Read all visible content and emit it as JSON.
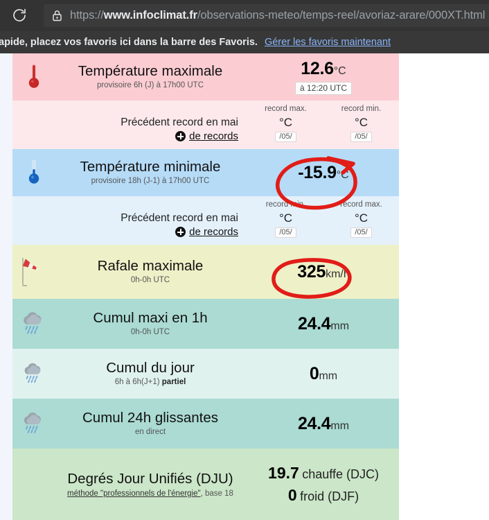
{
  "browser": {
    "reload_icon": "reload-icon",
    "lock_icon": "lock-icon",
    "url_scheme": "https://",
    "url_host": "www.infoclimat.fr",
    "url_path": "/observations-meteo/temps-reel/avoriaz-arare/000XT.html",
    "url_full": "https://www.infoclimat.fr/observations-meteo/temps-reel/avoriaz-arare/000XT.html"
  },
  "bookmarks_bar": {
    "message": "apide, placez vos favoris ici dans la barre des Favoris.",
    "link_label": "Gérer les favoris maintenant"
  },
  "rows": {
    "tmax": {
      "icon": "thermometer-red-icon",
      "title": "Température maximale",
      "subtitle": "provisoire 6h (J) à 17h00 UTC",
      "value": "12.6",
      "unit": "°C",
      "time_badge": "à 12:20 UTC"
    },
    "record_max": {
      "label": "Précédent record en mai",
      "more_label": "de records",
      "more_icon": "plus-circle-icon",
      "col1_header": "record max.",
      "col1_value": "°C",
      "col1_date": "/05/",
      "col2_header": "record min.",
      "col2_value": "°C",
      "col2_date": "/05/"
    },
    "tmin": {
      "icon": "thermometer-blue-icon",
      "title": "Température minimale",
      "subtitle": "provisoire 18h (J-1) à 17h00 UTC",
      "value": "-15.9",
      "unit": "°C"
    },
    "record_min": {
      "label": "Précédent record en mai",
      "more_label": "de records",
      "more_icon": "plus-circle-icon",
      "col1_header": "record min.",
      "col1_value": "°C",
      "col1_date": "/05/",
      "col2_header": "record max.",
      "col2_value": "°C",
      "col2_date": "/05/"
    },
    "gust": {
      "icon": "windsock-icon",
      "title": "Rafale maximale",
      "subtitle": "0h-0h UTC",
      "value": "325",
      "unit": "km/h"
    },
    "rain_1h": {
      "icon": "rain-cloud-icon",
      "title": "Cumul maxi en 1h",
      "subtitle": "0h-0h UTC",
      "value": "24.4",
      "unit": "mm"
    },
    "rain_day": {
      "icon": "rain-cloud-icon",
      "title": "Cumul du jour",
      "subtitle_plain": "6h à 6h(J+1) ",
      "subtitle_bold": "partiel",
      "value": "0",
      "unit": "mm"
    },
    "rain_24h": {
      "icon": "rain-cloud-icon",
      "title": "Cumul 24h glissantes",
      "subtitle": "en direct",
      "value": "24.4",
      "unit": "mm"
    },
    "dju": {
      "title": "Degrés Jour Unifiés (DJU)",
      "subtitle_link": "méthode \"professionnels de l'énergie\"",
      "subtitle_rest": ", base 18",
      "heat_value": "19.7",
      "heat_label": "chauffe (DJC)",
      "cold_value": "0",
      "cold_label": "froid (DJF)"
    }
  },
  "annotations": {
    "color": "#e11d18",
    "circle_tmin": "red-circle-annotation-tmin",
    "circle_gust": "red-circle-annotation-gust"
  }
}
